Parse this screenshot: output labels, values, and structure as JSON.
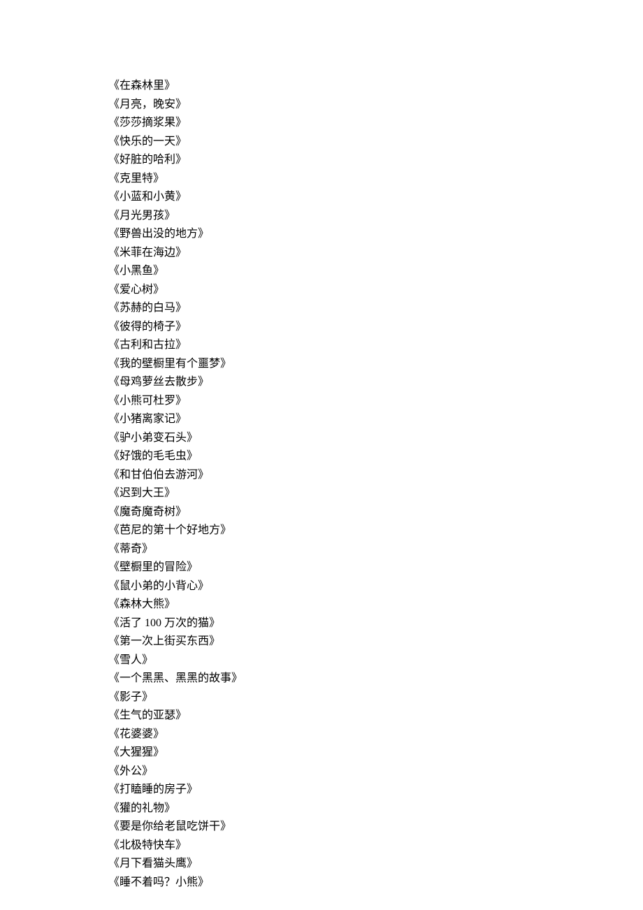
{
  "books": [
    "《在森林里》",
    "《月亮，晚安》",
    "《莎莎摘浆果》",
    "《快乐的一天》",
    "《好脏的哈利》",
    "《克里特》",
    "《小蓝和小黄》",
    "《月光男孩》",
    "《野兽出没的地方》",
    "《米菲在海边》",
    "《小黑鱼》",
    "《爱心树》",
    "《苏赫的白马》",
    "《彼得的椅子》",
    "《古利和古拉》",
    "《我的壁橱里有个噩梦》",
    "《母鸡萝丝去散步》",
    "《小熊可杜罗》",
    "《小猪离家记》",
    "《驴小弟变石头》",
    "《好饿的毛毛虫》",
    "《和甘伯伯去游河》",
    "《迟到大王》",
    "《魔奇魔奇树》",
    "《芭尼的第十个好地方》",
    "《蒂奇》",
    "《壁橱里的冒险》",
    "《鼠小弟的小背心》",
    "《森林大熊》",
    "《活了 100 万次的猫》",
    "《第一次上街买东西》",
    "《雪人》",
    "《一个黑黑、黑黑的故事》",
    "《影子》",
    "《生气的亚瑟》",
    "《花婆婆》",
    "《大猩猩》",
    "《外公》",
    "《打瞌睡的房子》",
    "《獾的礼物》",
    "《要是你给老鼠吃饼干》",
    "《北极特快车》",
    "《月下看猫头鹰》",
    "《睡不着吗？小熊》"
  ]
}
